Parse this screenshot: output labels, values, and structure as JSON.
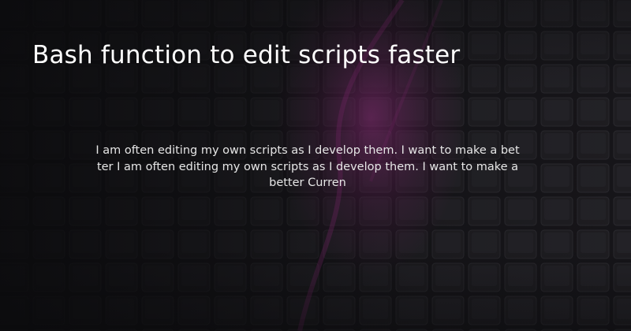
{
  "card": {
    "title": "Bash function to edit scripts faster",
    "description": "I am often editing my own scripts as I develop them. I want to make a better I am often editing my own scripts as I develop them. I want to make a better Curren"
  },
  "background": {
    "image": "keyboard-keys-photo",
    "base_color": "#141316",
    "accent_color": "#8a2a78"
  }
}
